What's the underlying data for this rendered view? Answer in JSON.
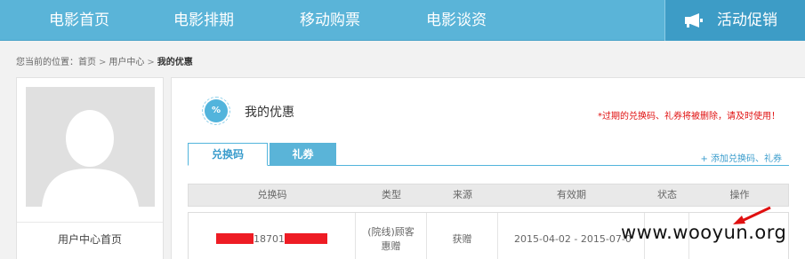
{
  "nav": {
    "items": [
      "电影首页",
      "电影排期",
      "移动购票",
      "电影谈资"
    ],
    "promo_label": "活动促销"
  },
  "breadcrumb": {
    "prefix": "您当前的位置：",
    "items": [
      "首页",
      "用户中心",
      "我的优惠"
    ],
    "separator": ">"
  },
  "sidebar": {
    "link_label": "用户中心首页"
  },
  "main": {
    "icon_text": "%",
    "title": "我的优惠",
    "warning": "*过期的兑换码、礼券将被删除，请及时使用！",
    "tabs": [
      {
        "label": "兑换码",
        "active": true
      },
      {
        "label": "礼券",
        "active": false
      }
    ],
    "add_link": "+ 添加兑换码、礼券",
    "table": {
      "headers": [
        "兑换码",
        "类型",
        "来源",
        "有效期",
        "状态",
        "操作"
      ],
      "rows": [
        {
          "code_visible": "18701",
          "type": "(院线)顾客惠赠",
          "source": "获赠",
          "validity": "2015-04-02 - 2015-07-0",
          "status": "",
          "action": ""
        }
      ]
    }
  },
  "watermark": "www.wooyun.org",
  "colors": {
    "nav_bg": "#5ab4d8",
    "promo_bg": "#3d9cc6",
    "warning": "#e01010",
    "redaction": "#ee1c24",
    "accent": "#52b4dc"
  },
  "icons": [
    "megaphone-icon",
    "coupon-percent-icon",
    "user-avatar-icon",
    "annotation-arrow-icon"
  ]
}
